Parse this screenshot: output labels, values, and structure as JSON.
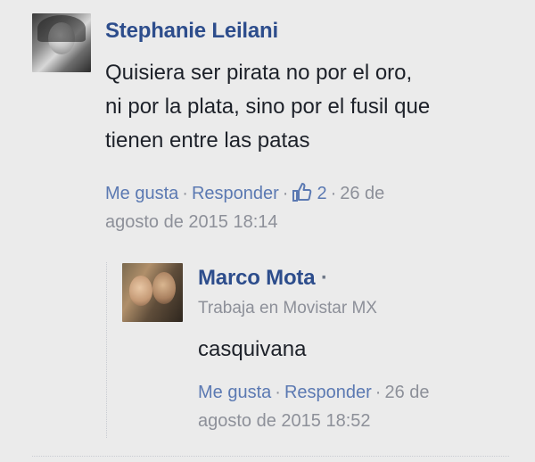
{
  "comment": {
    "author": "Stephanie Leilani",
    "text_lines": [
      "Quisiera ser pirata no por el oro,",
      "ni por la plata, sino por el fusil que",
      "tienen entre las patas"
    ],
    "like_label": "Me gusta",
    "reply_label": "Responder",
    "separator": "·",
    "like_count": "2",
    "date_line1": "26 de",
    "date_line2": "agosto de 2015 18:14",
    "like_icon": "thumbs-up-icon"
  },
  "reply": {
    "author": "Marco Mota",
    "author_suffix": "·",
    "subtitle": "Trabaja en Movistar MX",
    "text": "casquivana",
    "like_label": "Me gusta",
    "reply_label": "Responder",
    "separator": "·",
    "date_line1": "26 de",
    "date_line2": "agosto de 2015 18:52"
  },
  "colors": {
    "background": "#ebebeb",
    "name": "#2d4d8c",
    "link": "#5b79b2",
    "text": "#1d2129",
    "meta": "#8d9099"
  }
}
